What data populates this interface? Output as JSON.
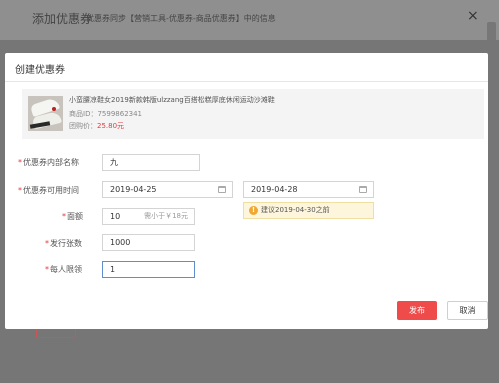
{
  "background": {
    "title": "添加优惠券",
    "subtitle": "优惠券同步【营销工具-优惠券-商品优惠券】中的信息",
    "close_symbol": "×"
  },
  "modal": {
    "title": "创建优惠券",
    "product": {
      "name": "小蛮腰凉鞋女2019新款韩版ulzzang百搭松糕厚底休闲运动沙滩鞋",
      "id_label": "商品ID：",
      "id_value": "7599862341",
      "price_label": "团购价：",
      "price_value": "25.80元"
    },
    "form": {
      "name_label": "优惠券内部名称",
      "name_value": "九",
      "time_label": "优惠券可用时间",
      "start_date": "2019-04-25",
      "date_separator": "-",
      "end_date": "2019-04-28",
      "tip": "建议2019-04-30之前",
      "tip_icon": "!",
      "amount_label": "面额",
      "amount_value": "10",
      "amount_hint": "需小于￥18元",
      "count_label": "发行张数",
      "count_value": "1000",
      "limit_label": "每人限领",
      "limit_value": "1",
      "required_mark": "*"
    },
    "buttons": {
      "publish": "发布",
      "cancel": "取消"
    }
  },
  "colors": {
    "accent": "#ef4b4b",
    "price": "#e4393c",
    "tip_background": "#fdf6dc",
    "tip_icon": "#f0a833",
    "focus_border": "#5d8fc9"
  }
}
